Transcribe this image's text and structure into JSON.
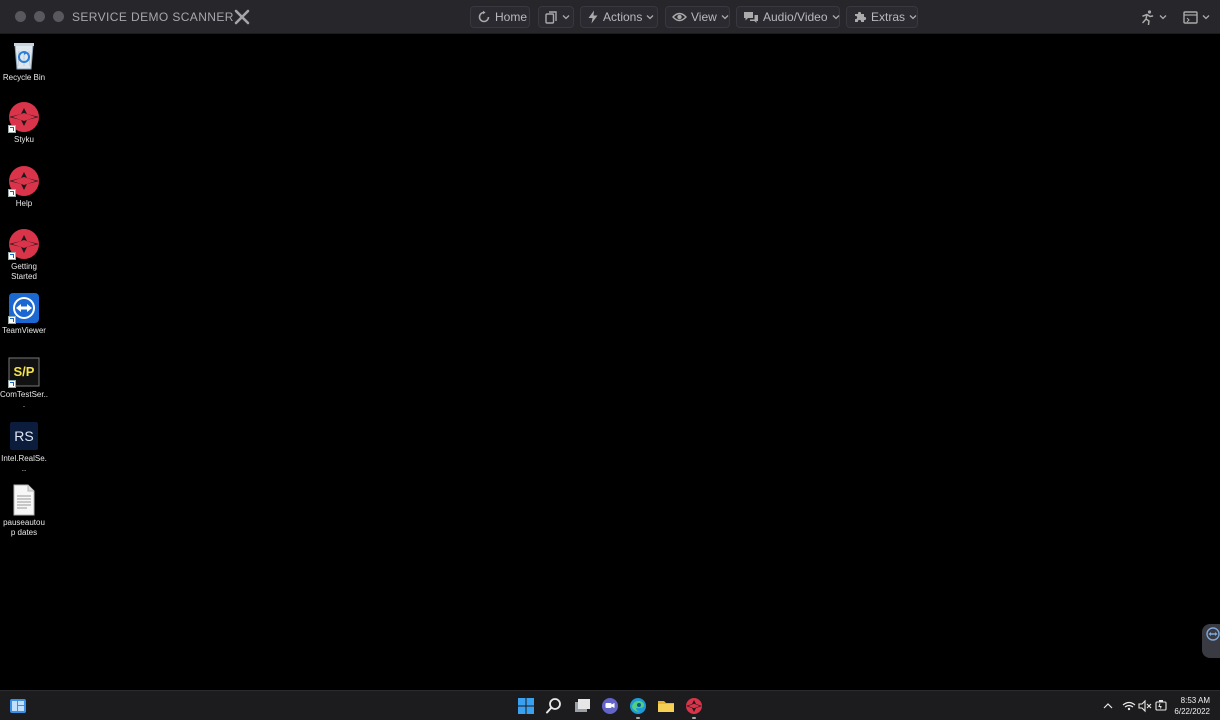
{
  "window": {
    "title": "SERVICE DEMO SCANNER"
  },
  "toolbar": {
    "home_label": "Home",
    "actions_label": "Actions",
    "view_label": "View",
    "audio_video_label": "Audio/Video",
    "extras_label": "Extras"
  },
  "desktop": {
    "icons": [
      {
        "label": "Recycle Bin",
        "icon": "recycle-bin-icon"
      },
      {
        "label": "Styku",
        "icon": "styku-icon"
      },
      {
        "label": "Help",
        "icon": "styku-icon"
      },
      {
        "label": "Getting Started",
        "icon": "styku-icon"
      },
      {
        "label": "TeamViewer",
        "icon": "teamviewer-icon"
      },
      {
        "label": "ComTestSer...",
        "icon": "sp-icon"
      },
      {
        "label": "Intel.RealSe...",
        "icon": "realsense-icon"
      },
      {
        "label": "pauseautoup dates",
        "icon": "document-icon"
      }
    ]
  },
  "taskbar": {
    "time": "8:53 AM",
    "date": "6/22/2022"
  },
  "colors": {
    "titlebar_bg": "#26262b",
    "desktop_bg": "#000000",
    "styku_red": "#d9344a",
    "teamviewer_blue": "#1c68d3",
    "taskbar_bg": "#1c1c1e"
  }
}
